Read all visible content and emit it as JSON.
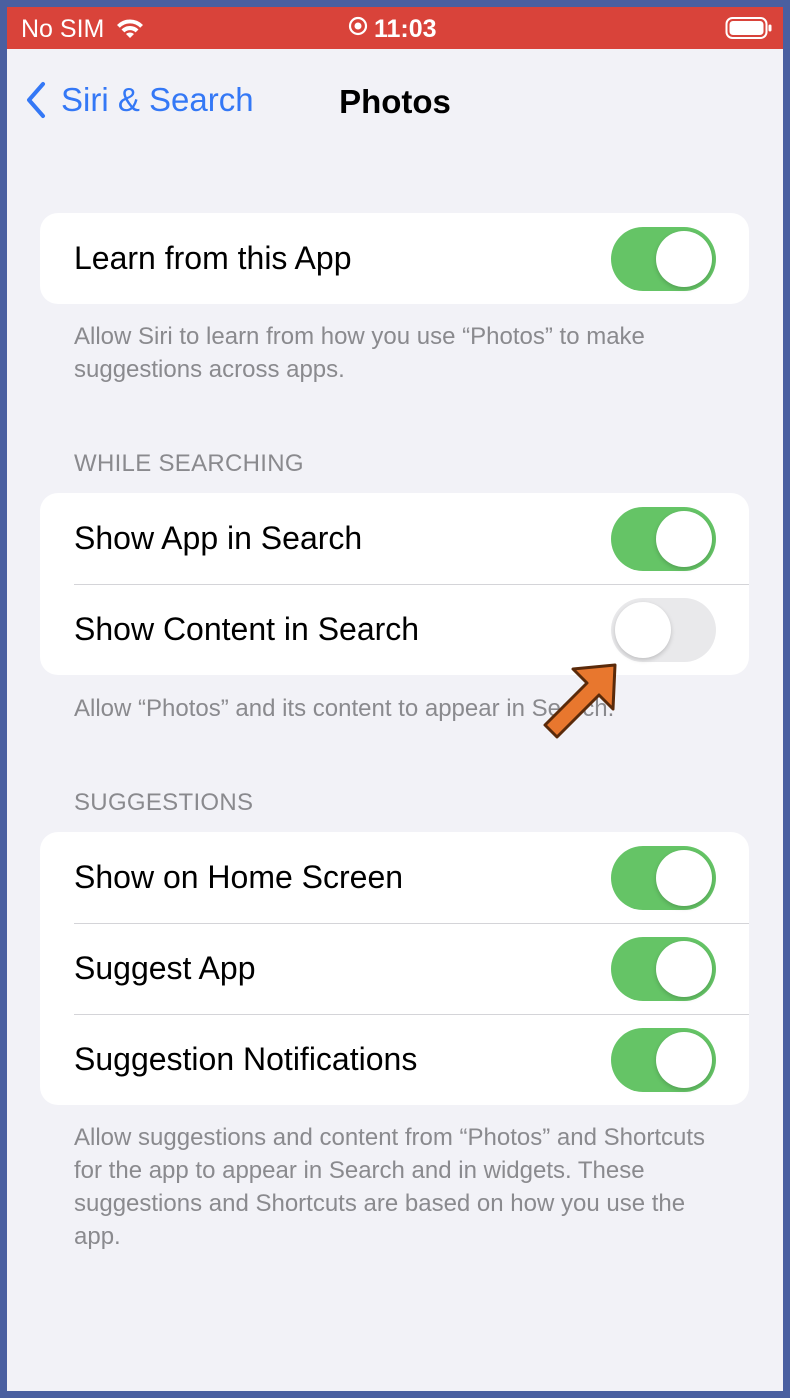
{
  "status_bar": {
    "carrier": "No SIM",
    "time": "11:03",
    "icons": [
      "wifi-icon",
      "location-icon",
      "battery-icon"
    ],
    "bar_color": "#d9433a"
  },
  "nav": {
    "back_label": "Siri & Search",
    "title": "Photos",
    "accent": "#3478f6"
  },
  "group1": {
    "rows": [
      {
        "label": "Learn from this App",
        "on": true
      }
    ],
    "footer": "Allow Siri to learn from how you use “Photos” to make suggestions across apps."
  },
  "group2": {
    "header": "WHILE SEARCHING",
    "rows": [
      {
        "label": "Show App in Search",
        "on": true
      },
      {
        "label": "Show Content in Search",
        "on": false
      }
    ],
    "footer": "Allow “Photos” and its content to appear in Search."
  },
  "group3": {
    "header": "SUGGESTIONS",
    "rows": [
      {
        "label": "Show on Home Screen",
        "on": true
      },
      {
        "label": "Suggest App",
        "on": true
      },
      {
        "label": "Suggestion Notifications",
        "on": true
      }
    ],
    "footer": "Allow suggestions and content from “Photos” and Shortcuts for the app to appear in Search and in widgets. These suggestions and Shortcuts are based on how you use the app."
  },
  "colors": {
    "toggle_on": "#65c466",
    "toggle_off": "#e9e9eb",
    "background": "#f2f2f7",
    "annotation_arrow": "#e8772e"
  }
}
